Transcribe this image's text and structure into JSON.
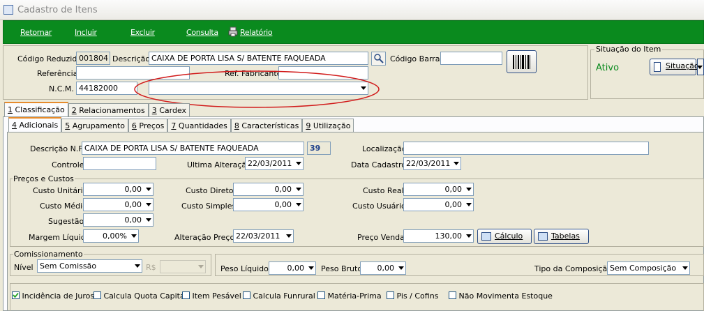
{
  "window": {
    "title": "Cadastro de Itens"
  },
  "toolbar": {
    "retornar": "Retornar",
    "incluir": "Incluir",
    "excluir": "Excluir",
    "consulta": "Consulta",
    "relatorio": "Relatório"
  },
  "header": {
    "codigo_label": "Código Reduzido",
    "codigo_value": "001804",
    "descricao_label": "Descrição",
    "descricao_value": "CAIXA DE PORTA LISA S/ BATENTE FAQUEADA",
    "codigo_barras_label": "Código Barras",
    "codigo_barras_value": "",
    "referencia_label": "Referência",
    "referencia_value": "",
    "ref_fabricante_label": "Ref. Fabricante",
    "ref_fabricante_value": "",
    "ncm_label": "N.C.M.",
    "ncm_value": "44182000",
    "ncm_desc_value": ""
  },
  "situacao": {
    "group_label": "Situação do Item",
    "status": "Ativo",
    "button_label": "Situação"
  },
  "tabs1": [
    {
      "num": "1",
      "label": " Classificação"
    },
    {
      "num": "2",
      "label": " Relacionamentos"
    },
    {
      "num": "3",
      "label": " Cardex"
    }
  ],
  "tabs2": [
    {
      "num": "4",
      "label": " Adicionais"
    },
    {
      "num": "5",
      "label": " Agrupamento"
    },
    {
      "num": "6",
      "label": " Preços"
    },
    {
      "num": "7",
      "label": " Quantidades"
    },
    {
      "num": "8",
      "label": " Características"
    },
    {
      "num": "9",
      "label": " Utilização"
    }
  ],
  "adicionais": {
    "desc_nf_label": "Descrição N.F.",
    "desc_nf_value": "CAIXA DE PORTA LISA S/ BATENTE FAQUEADA",
    "desc_nf_count": "39",
    "localizacao_label": "Localização",
    "localizacao_value": "",
    "controle_label": "Controle",
    "controle_value": "",
    "ultima_alt_label": "Ultima Alteração",
    "ultima_alt_value": "22/03/2011",
    "data_cad_label": "Data Cadastro",
    "data_cad_value": "22/03/2011"
  },
  "precos": {
    "group_label": "Preços e Custos",
    "custo_unitario_label": "Custo Unitário",
    "custo_unitario_value": "0,00",
    "custo_direto_label": "Custo Direto",
    "custo_direto_value": "0,00",
    "custo_real_label": "Custo Real",
    "custo_real_value": "0,00",
    "custo_medio_label": "Custo Médio",
    "custo_medio_value": "0,00",
    "custo_simples_label": "Custo Simples",
    "custo_simples_value": "0,00",
    "custo_usuario_label": "Custo Usuário",
    "custo_usuario_value": "0,00",
    "sugestao_label": "Sugestão",
    "sugestao_value": "0,00",
    "margem_label": "Margem Líquida",
    "margem_value": "0,00%",
    "alt_preco_label": "Alteração Preço",
    "alt_preco_value": "22/03/2011",
    "preco_venda_label": "Preço Venda",
    "preco_venda_value": "130,00",
    "calculo_button": "Cálculo",
    "tabelas_button": "Tabelas"
  },
  "comissao": {
    "group_label": "Comissionamento",
    "nivel_label": "Nível",
    "nivel_value": "Sem Comissão",
    "rs_label": "R$",
    "rs_value": "",
    "peso_liquido_label": "Peso Líquido",
    "peso_liquido_value": "0,00",
    "peso_bruto_label": "Peso Bruto",
    "peso_bruto_value": "0,00",
    "tipo_comp_label": "Tipo da Composição",
    "tipo_comp_value": "Sem Composição"
  },
  "checkboxes": [
    {
      "label": "Incidência de Juros",
      "checked": true
    },
    {
      "label": "Calcula Quota Capital",
      "checked": false
    },
    {
      "label": "Item Pesável",
      "checked": false
    },
    {
      "label": "Calcula Funrural",
      "checked": false
    },
    {
      "label": "Matéria-Prima",
      "checked": false
    },
    {
      "label": "Pis / Cofins",
      "checked": false
    },
    {
      "label": "Não Movimenta Estoque",
      "checked": false
    }
  ],
  "annotation": {
    "color": "#d11a1a"
  }
}
